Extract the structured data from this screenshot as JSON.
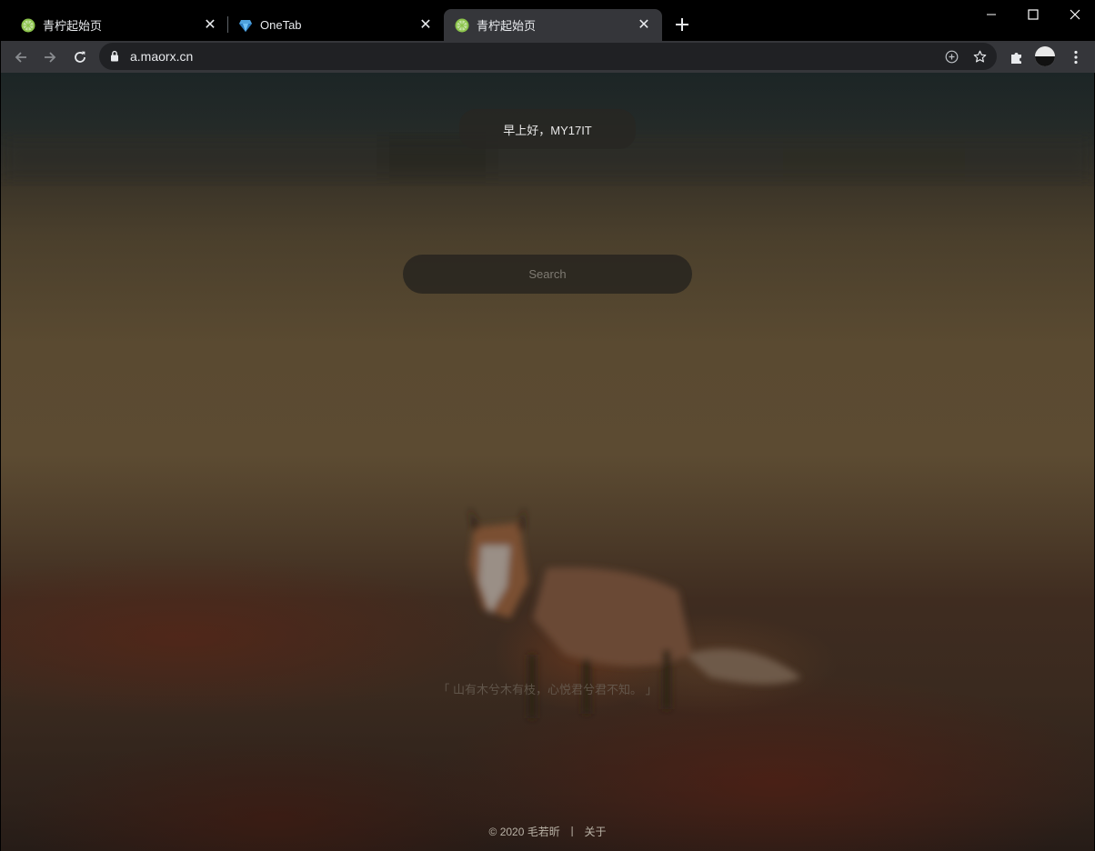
{
  "tabs": [
    {
      "title": "青柠起始页",
      "favicon": "lime-icon",
      "active": false
    },
    {
      "title": "OneTab",
      "favicon": "onetab-icon",
      "active": false
    },
    {
      "title": "青柠起始页",
      "favicon": "lime-icon",
      "active": true
    }
  ],
  "toolbar": {
    "url": "a.maorx.cn"
  },
  "page": {
    "greeting": "早上好，MY17IT",
    "search_placeholder": "Search",
    "quote": "「 山有木兮木有枝，心悦君兮君不知。 」",
    "footer": {
      "copyright": "© 2020 毛若昕",
      "separator": "丨",
      "about": "关于"
    }
  },
  "colors": {
    "tab_active": "#35363a",
    "tabstrip": "#000000",
    "omnibox": "#202124",
    "lime_favicon": "#8bc34a"
  }
}
